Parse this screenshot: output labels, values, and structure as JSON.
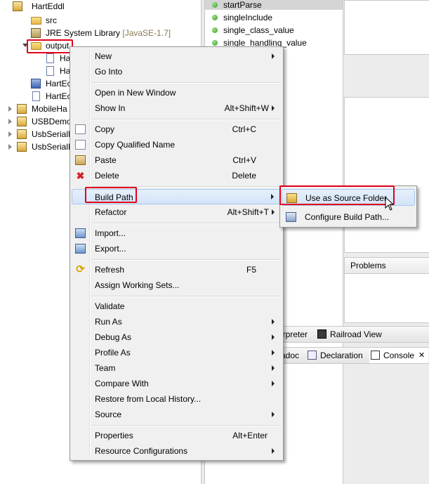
{
  "explorer": {
    "rows": [
      {
        "label": "HartEddl"
      },
      {
        "label": "src"
      },
      {
        "label": "JRE System Library",
        "extra": "[JavaSE-1.7]"
      },
      {
        "label": "output"
      },
      {
        "label": "Har"
      },
      {
        "label": "Ha"
      },
      {
        "label": "HartEc"
      },
      {
        "label": "HartEc"
      },
      {
        "label": "MobileHa"
      },
      {
        "label": "USBDemo"
      },
      {
        "label": "UsbSerialE"
      },
      {
        "label": "UsbSerialL"
      }
    ]
  },
  "outline": {
    "items": [
      "startParse",
      "singleInclude",
      "single_class_value",
      "single_handling_value"
    ]
  },
  "panels": {
    "problems": "Problems",
    "tabs_top": [
      "erpreter",
      "Railroad View"
    ],
    "tabs_bottom": [
      "adoc",
      "Declaration",
      "Console"
    ]
  },
  "context_menu": {
    "items": [
      {
        "label": "New",
        "shortcut": "",
        "submenu": true
      },
      {
        "label": "Go Into",
        "shortcut": ""
      },
      {
        "label": "Open in New Window",
        "shortcut": ""
      },
      {
        "label": "Show In",
        "shortcut": "Alt+Shift+W",
        "submenu": true
      },
      {
        "label": "Copy",
        "shortcut": "Ctrl+C",
        "icon": "copy-icon"
      },
      {
        "label": "Copy Qualified Name",
        "shortcut": "",
        "icon": "copy-icon"
      },
      {
        "label": "Paste",
        "shortcut": "Ctrl+V",
        "icon": "paste-icon"
      },
      {
        "label": "Delete",
        "shortcut": "Delete",
        "icon": "delete-icon"
      },
      {
        "label": "Build Path",
        "shortcut": "",
        "submenu": true
      },
      {
        "label": "Refactor",
        "shortcut": "Alt+Shift+T",
        "submenu": true
      },
      {
        "label": "Import...",
        "shortcut": "",
        "icon": "import-icon"
      },
      {
        "label": "Export...",
        "shortcut": "",
        "icon": "export-icon"
      },
      {
        "label": "Refresh",
        "shortcut": "F5",
        "icon": "refresh-icon"
      },
      {
        "label": "Assign Working Sets...",
        "shortcut": ""
      },
      {
        "label": "Validate",
        "shortcut": ""
      },
      {
        "label": "Run As",
        "shortcut": "",
        "submenu": true
      },
      {
        "label": "Debug As",
        "shortcut": "",
        "submenu": true
      },
      {
        "label": "Profile As",
        "shortcut": "",
        "submenu": true
      },
      {
        "label": "Team",
        "shortcut": "",
        "submenu": true
      },
      {
        "label": "Compare With",
        "shortcut": "",
        "submenu": true
      },
      {
        "label": "Restore from Local History...",
        "shortcut": ""
      },
      {
        "label": "Source",
        "shortcut": "",
        "submenu": true
      },
      {
        "label": "Properties",
        "shortcut": "Alt+Enter"
      },
      {
        "label": "Resource Configurations",
        "shortcut": "",
        "submenu": true
      }
    ]
  },
  "build_path_submenu": {
    "items": [
      {
        "label": "Use as Source Folder",
        "icon": "source-folder-icon"
      },
      {
        "label": "Configure Build Path...",
        "icon": "build-path-icon"
      }
    ]
  },
  "colors": {
    "highlight_box": "#e3001b",
    "menu_bg": "#f0f0f0",
    "hover_bg": "#d3e4f8"
  }
}
